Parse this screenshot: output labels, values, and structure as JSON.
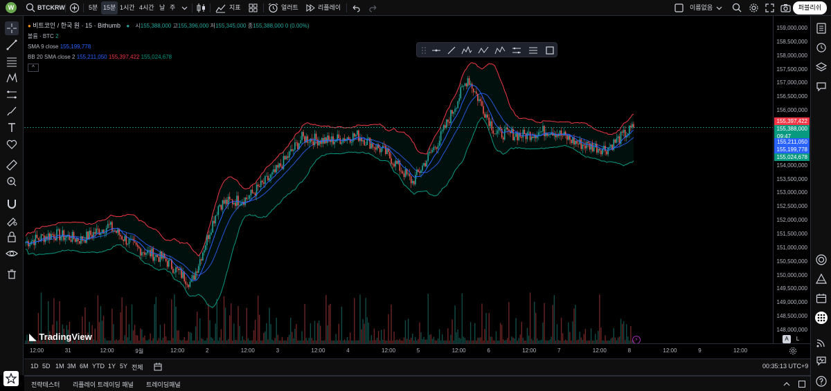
{
  "toolbar": {
    "avatar_letter": "W",
    "symbol": "BTCKRW",
    "intervals": [
      "5분",
      "15분",
      "1시간",
      "4시간",
      "날",
      "주"
    ],
    "active_interval": "15분",
    "indicators_label": "지표",
    "alert_label": "얼러트",
    "replay_label": "리플레이",
    "layout_name": "이름없음",
    "publish_label": "퍼블리쉬"
  },
  "legend": {
    "symbol_title": "비트코인 / 한국 원 · 15 · Bithumb",
    "ohlc": {
      "o_label": "시",
      "o_value": "155,388,000",
      "h_label": "고",
      "h_value": "155,396,000",
      "l_label": "저",
      "l_value": "155,345,000",
      "c_label": "종",
      "c_value": "155,388,000",
      "change": "0 (0.00%)"
    },
    "volume": {
      "label": "볼륨 · BTC",
      "value": "2"
    },
    "sma": {
      "label": "SMA 9 close",
      "value": "155,199,778"
    },
    "bb": {
      "label": "BB 20 SMA close 2",
      "basis": "155,211,050",
      "upper": "155,397,422",
      "lower": "155,024,678"
    },
    "collapse_label": "^"
  },
  "watermark": "TradingView",
  "price_axis": {
    "labels": [
      "159,000,000",
      "158,500,000",
      "158,000,000",
      "157,500,000",
      "157,000,000",
      "156,500,000",
      "156,000,000",
      "155,500,000",
      "154,000,000",
      "153,500,000",
      "153,000,000",
      "152,500,000",
      "152,000,000",
      "151,500,000",
      "151,000,000",
      "150,500,000",
      "150,000,000",
      "149,500,000",
      "149,000,000",
      "148,500,000",
      "148,000,000"
    ],
    "tags": {
      "bb_upper": "155,397,422",
      "last_price": "155,388,000",
      "countdown": "09:47",
      "bb_basis": "155,211,050",
      "sma": "155,199,778",
      "bb_lower": "155,024,678"
    },
    "auto_label": "A",
    "log_label": "L"
  },
  "time_axis": {
    "labels": [
      "12:00",
      "31",
      "12:00",
      "9월",
      "12:00",
      "2",
      "12:00",
      "3",
      "12:00",
      "4",
      "12:00",
      "5",
      "12:00",
      "6",
      "12:00",
      "7",
      "12:00",
      "8",
      "12:00",
      "9",
      "12:00"
    ]
  },
  "range_bar": {
    "ranges": [
      "1D",
      "5D",
      "1M",
      "3M",
      "6M",
      "YTD",
      "1Y",
      "5Y",
      "전체"
    ],
    "clock": "00:35:13 UTC+9"
  },
  "bottom_panel": {
    "tabs": [
      "전략테스터",
      "리플레이 트레이딩 패널",
      "트레이딩패널"
    ]
  },
  "colors": {
    "up": "#26a69a",
    "down": "#ef5350",
    "bb_upper": "#f23645",
    "bb_lower": "#089981",
    "sma": "#2962ff",
    "basis": "#2962ff"
  },
  "chart_data": {
    "type": "candlestick",
    "symbol": "비트코인 / 한국 원 · 15 · Bithumb",
    "ylim": [
      148000000,
      159000000
    ],
    "x": [
      "8/30 12:00",
      "8/31",
      "8/31 12:00",
      "9/1",
      "9/1 12:00",
      "9/2",
      "9/2 12:00",
      "9/3",
      "9/3 12:00",
      "9/4",
      "9/4 12:00",
      "9/5",
      "9/5 12:00",
      "9/6",
      "9/6 12:00",
      "9/7",
      "9/7 12:00",
      "9/8"
    ],
    "series": [
      {
        "name": "close",
        "values": [
          151200000,
          151500000,
          151300000,
          151800000,
          151000000,
          150600000,
          149700000,
          152600000,
          152800000,
          153700000,
          155000000,
          154900000,
          155100000,
          154500000,
          153400000,
          155000000,
          157200000,
          155200000,
          155100000,
          155300000,
          154800000,
          154600000,
          155388000
        ]
      }
    ]
  }
}
